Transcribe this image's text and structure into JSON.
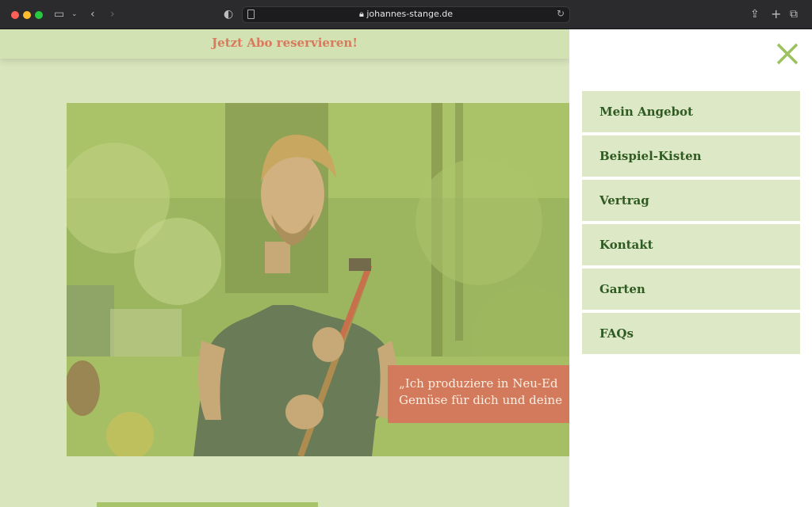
{
  "browser": {
    "url": "johannes-stange.de",
    "icons": [
      "sidebar-icon",
      "chevron-down-icon",
      "back-icon",
      "forward-icon",
      "shield-icon",
      "reader-icon",
      "lock-icon",
      "reload-icon",
      "share-icon",
      "new-tab-icon",
      "tabs-icon"
    ]
  },
  "site": {
    "promo_text": "Jetzt Abo reservieren!",
    "quote_line1": "„Ich produziere in Neu-Ed",
    "quote_line2": "Gemüse für dich und deine"
  },
  "menu": {
    "items": [
      {
        "label": "Mein Angebot"
      },
      {
        "label": "Beispiel-Kisten"
      },
      {
        "label": "Vertrag"
      },
      {
        "label": "Kontakt"
      },
      {
        "label": "Garten"
      },
      {
        "label": "FAQs"
      }
    ]
  },
  "colors": {
    "background": "#d8e5bd",
    "accent_green": "#a8c46a",
    "menu_item_bg": "#dde9c6",
    "menu_text": "#2f5a22",
    "promo_text": "#d97a5e",
    "quote_bg": "#d27a5b"
  }
}
